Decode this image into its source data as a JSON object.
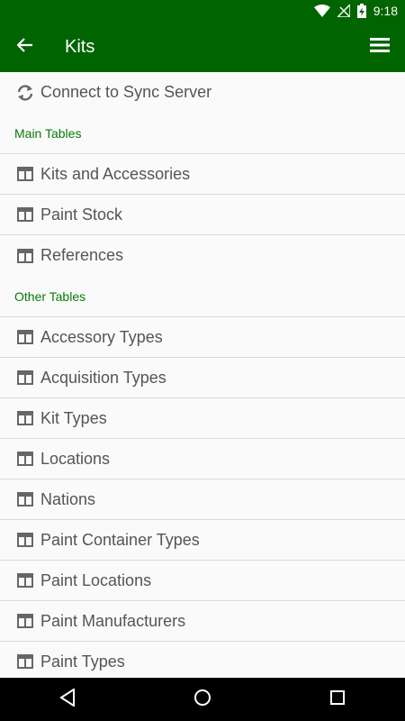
{
  "status_bar": {
    "time": "9:18",
    "icons": [
      "wifi-icon",
      "no-signal-icon",
      "battery-charging-icon"
    ]
  },
  "app_bar": {
    "title": "Kits",
    "back_icon": "arrow-back-icon",
    "menu_icon": "menu-icon"
  },
  "sync": {
    "label": "Connect to Sync Server",
    "icon": "sync-icon"
  },
  "sections": [
    {
      "header": "Main Tables",
      "items": [
        {
          "label": "Kits and Accessories",
          "icon": "table-icon"
        },
        {
          "label": "Paint Stock",
          "icon": "table-icon"
        },
        {
          "label": "References",
          "icon": "table-icon"
        }
      ]
    },
    {
      "header": "Other Tables",
      "items": [
        {
          "label": "Accessory Types",
          "icon": "table-icon"
        },
        {
          "label": "Acquisition Types",
          "icon": "table-icon"
        },
        {
          "label": "Kit Types",
          "icon": "table-icon"
        },
        {
          "label": "Locations",
          "icon": "table-icon"
        },
        {
          "label": "Nations",
          "icon": "table-icon"
        },
        {
          "label": "Paint Container Types",
          "icon": "table-icon"
        },
        {
          "label": "Paint Locations",
          "icon": "table-icon"
        },
        {
          "label": "Paint Manufacturers",
          "icon": "table-icon"
        },
        {
          "label": "Paint Types",
          "icon": "table-icon"
        }
      ]
    }
  ],
  "nav_bar": {
    "icons": [
      "back-triangle-icon",
      "home-circle-icon",
      "recents-square-icon"
    ]
  },
  "colors": {
    "primary": "#006400",
    "section_header": "#0a7a0a",
    "text": "#555555",
    "background": "#fafafa",
    "divider": "#d9d9d9"
  }
}
